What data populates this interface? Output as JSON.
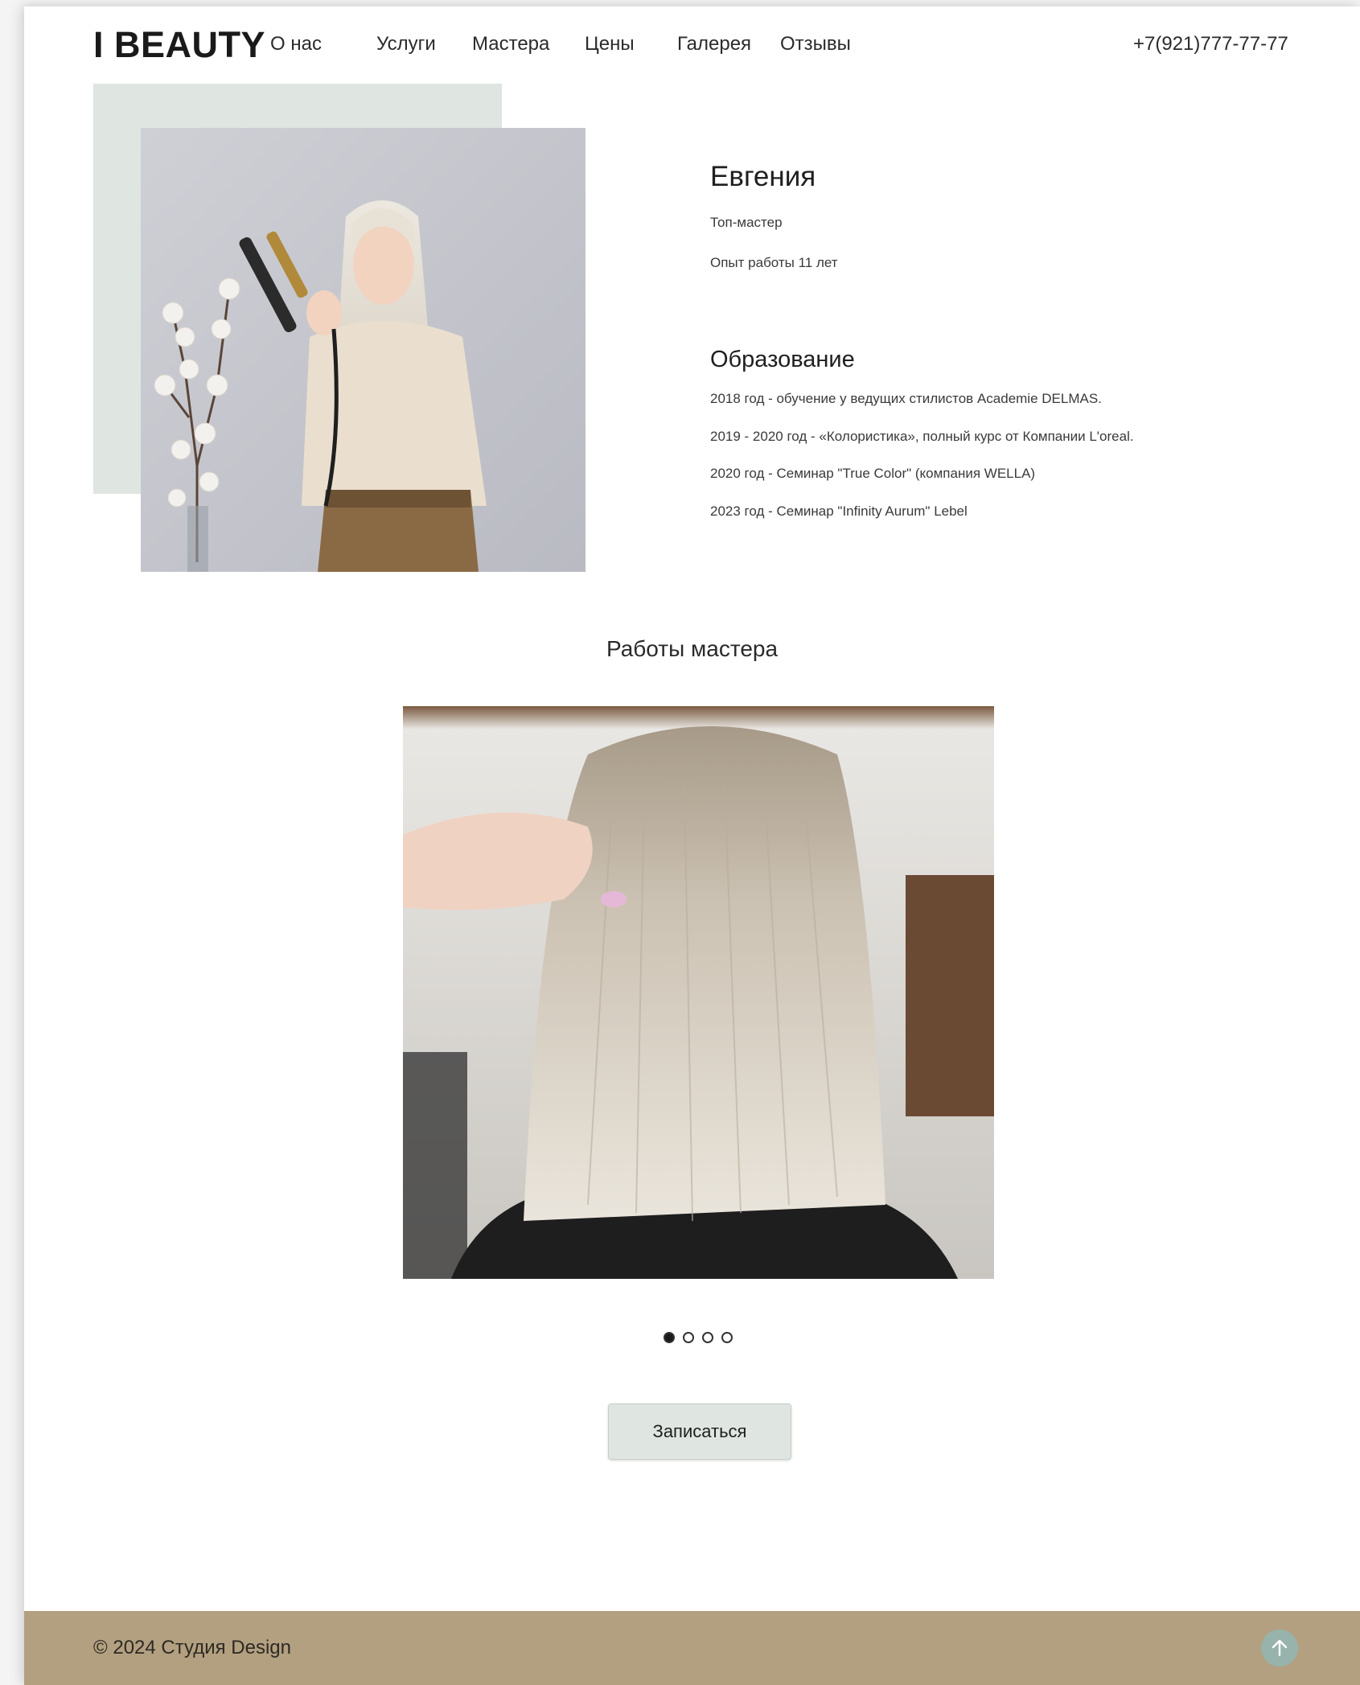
{
  "header": {
    "logo": "I BEAUTY",
    "nav": [
      "О нас",
      "Услуги",
      "Мастера",
      "Цены",
      "Галерея",
      "Отзывы"
    ],
    "phone": "+7(921)777-77-77"
  },
  "master": {
    "name": "Евгения",
    "role": "Топ-мастер",
    "experience": "Опыт работы 11 лет",
    "education_title": "Образование",
    "education": [
      "2018 год - обучение у ведущих стилистов Academie DELMAS.",
      "2019 - 2020 год - «Колористика», полный курс от Компании L'oreal.",
      "2020 год - Семинар \"True Color\" (компания WELLA)",
      "2023 год - Семинар \"Infinity Aurum\" Lebel"
    ]
  },
  "works": {
    "title": "Работы мастера",
    "slide_count": 4,
    "active_slide": 1
  },
  "booking": {
    "button_label": "Записаться"
  },
  "footer": {
    "copyright": "© 2024 Студия Design",
    "up_icon": "arrow-up-icon"
  },
  "colors": {
    "accent_green": "#dfe5e1",
    "footer_bg": "#b3a080",
    "up_button": "#98b3ab"
  }
}
